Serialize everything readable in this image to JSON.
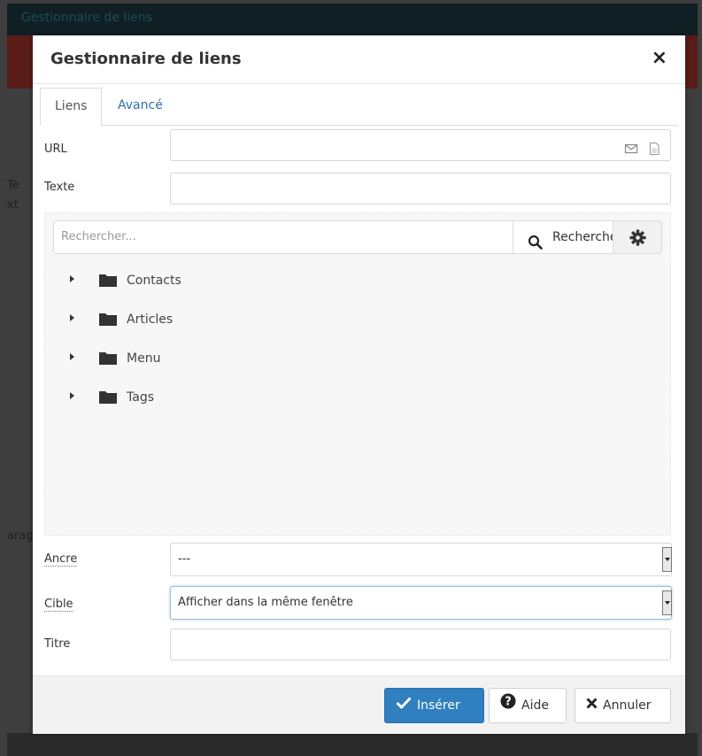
{
  "background": {
    "topbar_text": "Gestionnaire de liens",
    "left_fragments": [
      "Te",
      "xt",
      "arag"
    ]
  },
  "modal": {
    "title": "Gestionnaire de liens",
    "close_label": "×"
  },
  "tabs": [
    {
      "label": "Liens",
      "active": true
    },
    {
      "label": "Avancé",
      "active": false
    }
  ],
  "fields": {
    "url": {
      "label": "URL",
      "value": ""
    },
    "text": {
      "label": "Texte",
      "value": ""
    },
    "anchor": {
      "label": "Ancre",
      "value": "---"
    },
    "target": {
      "label": "Cible",
      "value": "Afficher dans la même fenêtre"
    },
    "title": {
      "label": "Titre",
      "value": ""
    }
  },
  "browser": {
    "search_placeholder": "Rechercher...",
    "search_button": "Recherche",
    "tree": [
      {
        "label": "Contacts"
      },
      {
        "label": "Articles"
      },
      {
        "label": "Menu"
      },
      {
        "label": "Tags"
      }
    ]
  },
  "footer": {
    "insert_label": "Insérer",
    "help_label": "Aide",
    "cancel_label": "Annuler"
  },
  "colors": {
    "primary": "#2f7fc1",
    "tab_link": "#2f6eb5"
  },
  "icons": [
    "close-icon",
    "email-icon",
    "file-icon",
    "search-icon",
    "gear-icon",
    "caret-right-icon",
    "folder-icon",
    "check-icon",
    "question-icon",
    "x-icon"
  ]
}
